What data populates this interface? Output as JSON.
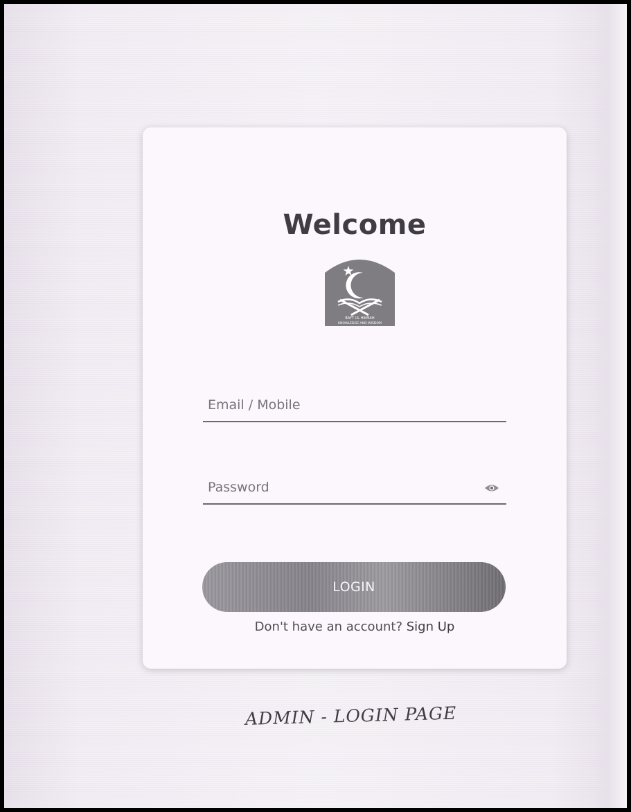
{
  "login_card": {
    "title": "Welcome",
    "logo": {
      "icon": "crescent-star-book-emblem-icon",
      "caption_line1": "BAYT UL HIKMAH",
      "caption_line2": "KNOWLEDGE AND WISDOM"
    },
    "email_field": {
      "placeholder": "Email / Mobile",
      "value": ""
    },
    "password_field": {
      "placeholder": "Password",
      "value": "",
      "toggle_icon": "eye-icon"
    },
    "login_button": {
      "label": "LOGIN"
    },
    "signup_prompt": {
      "text": "Don't have an account?",
      "link_label": "Sign Up"
    }
  },
  "page_caption": "ADMIN - LOGIN PAGE",
  "colors": {
    "page_background": "#efe9f2",
    "card_background": "#fbf7fc",
    "title_text": "#3f3d43",
    "button_gradient_start": "#9a979d",
    "button_gradient_end": "#6f6c72",
    "underline": "#6b6870"
  }
}
